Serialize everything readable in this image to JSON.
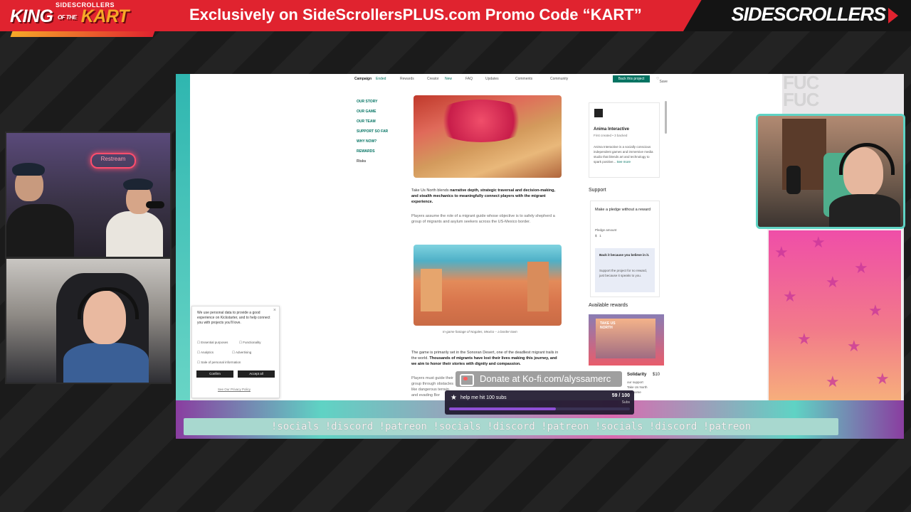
{
  "banner": {
    "logo_top": "SIDESCROLLERS",
    "logo_main": "KING",
    "logo_of": "OF THE",
    "logo_kart": "KART",
    "promo": "Exclusively on SideScrollersPLUS.com  Promo Code “KART”",
    "brand_side": "SIDE",
    "brand_scrollers": "SCROLLERS"
  },
  "page_nav": {
    "campaign": "Campaign",
    "ended": "Ended",
    "rewards": "Rewards",
    "creator": "Creator",
    "new": "New",
    "faq": "FAQ",
    "updates": "Updates",
    "comments": "Comments",
    "community": "Community",
    "back_button": "Back this project",
    "save": "Save"
  },
  "side_menu": [
    "OUR STORY",
    "OUR GAME",
    "OUR TEAM",
    "SUPPORT SO FAR",
    "WHY NOW?",
    "REWARDS",
    "Risks"
  ],
  "story": {
    "para1_a": "Take Us North blends ",
    "para1_b": "narrative depth, strategic traversal and decision-making, and stealth mechanics to meaningfully connect players with the migrant experience.",
    "para2": "Players assume the role of a migrant guide whose objective is to safely shepherd a group of migrants and asylum seekers across the US-Mexico border.",
    "caption": "In-game footage of Nogales, Mexico – a border town",
    "para3_a": "The game is primarily set in the Sonoran Desert, one of the deadliest migrant trails in the world. ",
    "para3_b": "Thousands of migrants have lost their lives making this journey, and we aim to honor their stories with dignity and compassion.",
    "para4": "Players must guide their group through obstacles like dangerous terrain and evading Bor"
  },
  "creator": {
    "name": "Anima Interactive",
    "meta": "First created • 3 backed",
    "bio": "Anima Interactive is a socially conscious independent games and immersive media studio that blends art and technology to spark positive...",
    "see_more": "See more"
  },
  "support": {
    "title": "Support",
    "pledge_title": "Make a pledge without a reward",
    "pledge_label": "Pledge amount",
    "pledge_currency": "$",
    "pledge_value": "1",
    "box_title": "Back it because you believe in it.",
    "box_text": "Support the project for no reward, just because it speaks to you."
  },
  "rewards": {
    "title": "Available rewards",
    "reward_img_text": "TAKE US NORTH",
    "reward_name": "Solidarity",
    "reward_price": "$10",
    "reward_snippet_1": "our support",
    "reward_snippet_2": "Take Us North",
    "reward_snippet_3": "and some"
  },
  "cookie": {
    "text": "We use personal data to provide a good experience on Kickstarter, and to help connect you with projects you'll love.",
    "opt1": "Essential purposes",
    "opt2": "Functionality",
    "opt3": "Analytics",
    "opt4": "Advertising",
    "opt5": "Sale of personal information",
    "confirm": "Confirm",
    "accept": "Accept all",
    "privacy": "See Our Privacy Policy",
    "close": "×"
  },
  "overlay": {
    "fuck_text_1": "FUC",
    "fuck_text_2": "FUC",
    "donate": "Donate at Ko-fi.com/alyssamerc",
    "goal_title": "help me hit 100 subs",
    "goal_count": "59 / 100",
    "goal_unit": "Subs",
    "goal_progress": 0.59,
    "socials": "!socials !discord !patreon !socials !discord !patreon !socials !discord !patreon",
    "neon_sign": "Restream"
  },
  "colors": {
    "banner_red": "#e0232f",
    "kickstarter_green": "#037362",
    "frame_teal": "#5fd3c4",
    "pink": "#ef4ea8"
  }
}
